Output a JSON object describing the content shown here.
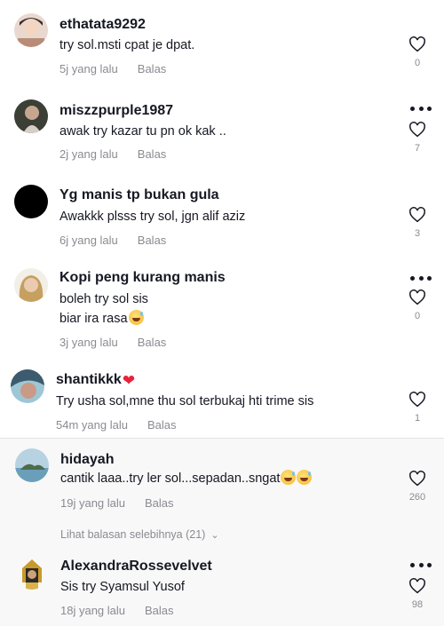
{
  "comments": [
    {
      "username": "ethatata9292",
      "text": [
        "try sol.msti cpat je dpat."
      ],
      "time": "5j yang lalu",
      "reply_label": "Balas",
      "likes": "0",
      "has_more_menu": false,
      "avatar_icon": "user-photo-avatar"
    },
    {
      "username": "miszzpurple1987",
      "text": [
        "awak try kazar tu pn ok kak .."
      ],
      "time": "2j yang lalu",
      "reply_label": "Balas",
      "likes": "7",
      "has_more_menu": true,
      "avatar_icon": "user-photo-avatar"
    },
    {
      "username": "Yg manis tp bukan gula",
      "text": [
        "Awakkk plsss try sol, jgn alif aziz"
      ],
      "time": "6j yang lalu",
      "reply_label": "Balas",
      "likes": "3",
      "has_more_menu": false,
      "avatar_icon": "black-circle-avatar"
    },
    {
      "username": "Kopi peng kurang manis",
      "text": [
        "boleh try sol sis",
        "biar ira rasa"
      ],
      "time": "3j yang lalu",
      "reply_label": "Balas",
      "likes": "0",
      "has_more_menu": true,
      "avatar_icon": "user-photo-avatar"
    },
    {
      "username": "shantikkk",
      "text": [
        "Try usha sol,mne thu sol terbukaj hti trime sis"
      ],
      "time": "54m yang lalu",
      "reply_label": "Balas",
      "likes": "1",
      "has_more_menu": false,
      "avatar_icon": "user-photo-avatar"
    },
    {
      "username": "hidayah",
      "text": [
        "cantik laaa..try ler sol...sepadan..sngat"
      ],
      "time": "19j yang lalu",
      "reply_label": "Balas",
      "likes": "260",
      "has_more_menu": false,
      "avatar_icon": "landscape-avatar"
    },
    {
      "username": "AlexandraRossevelvet",
      "text": [
        "Sis try Syamsul Yusof"
      ],
      "time": "18j yang lalu",
      "reply_label": "Balas",
      "likes": "98",
      "has_more_menu": true,
      "avatar_icon": "pharaoh-avatar"
    }
  ],
  "view_more_replies": "Lihat balasan selebihnya (21)",
  "colors": {
    "text": "#161823",
    "muted": "#8a8b91",
    "heart_red": "#e8223a",
    "bottom_bg": "#f8f8f8"
  }
}
